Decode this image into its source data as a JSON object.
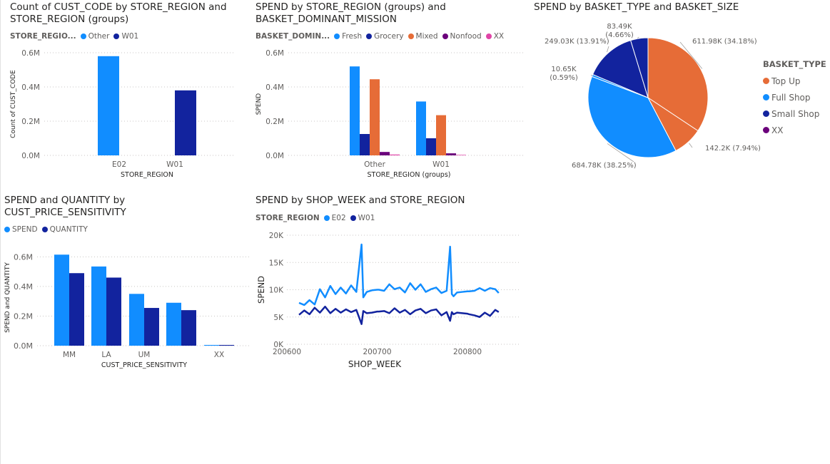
{
  "colors": {
    "light_blue": "#118dff",
    "dark_blue": "#12239e",
    "orange": "#e66c37",
    "purple": "#6b007b",
    "pink": "#e044a7",
    "axis_text": "#605e5c",
    "grid": "#c8c6c4"
  },
  "chart_data": [
    {
      "type": "bar",
      "title": "Count of CUST_CODE by STORE_REGION and\nSTORE_REGION (groups)",
      "legend_title": "STORE_REGIO...",
      "legend": [
        "Other",
        "W01"
      ],
      "categories": [
        "E02",
        "W01"
      ],
      "series": [
        {
          "name": "Other",
          "values": [
            580000,
            0
          ]
        },
        {
          "name": "W01",
          "values": [
            0,
            380000
          ]
        }
      ],
      "xlabel": "STORE_REGION",
      "ylabel": "Count of CUST_CODE",
      "ylim": [
        0,
        600000
      ],
      "yticks": [
        "0.0M",
        "0.2M",
        "0.4M",
        "0.6M"
      ],
      "grid": true
    },
    {
      "type": "bar",
      "title": "SPEND by STORE_REGION (groups) and\nBASKET_DOMINANT_MISSION",
      "legend_title": "BASKET_DOMIN...",
      "legend": [
        "Fresh",
        "Grocery",
        "Mixed",
        "Nonfood",
        "XX"
      ],
      "categories": [
        "Other",
        "W01"
      ],
      "series": [
        {
          "name": "Fresh",
          "values": [
            520000,
            315000
          ]
        },
        {
          "name": "Grocery",
          "values": [
            125000,
            100000
          ]
        },
        {
          "name": "Mixed",
          "values": [
            445000,
            235000
          ]
        },
        {
          "name": "Nonfood",
          "values": [
            20000,
            12000
          ]
        },
        {
          "name": "XX",
          "values": [
            5000,
            3000
          ]
        }
      ],
      "xlabel": "STORE_REGION (groups)",
      "ylabel": "SPEND",
      "ylim": [
        0,
        600000
      ],
      "yticks": [
        "0.0M",
        "0.2M",
        "0.4M",
        "0.6M"
      ],
      "grid": true
    },
    {
      "type": "pie",
      "title": "SPEND by BASKET_TYPE and BASKET_SIZE",
      "legend_title": "BASKET_TYPE",
      "legend": [
        "Top Up",
        "Full Shop",
        "Small Shop",
        "XX"
      ],
      "slices": [
        {
          "label": "611.98K (34.18%)",
          "value": 611.98,
          "color": "#e66c37"
        },
        {
          "label": "142.2K (7.94%)",
          "value": 142.2,
          "color": "#e66c37"
        },
        {
          "label": "684.78K (38.25%)",
          "value": 684.78,
          "color": "#118dff"
        },
        {
          "label": "10.65K\n(0.59%)",
          "value": 10.65,
          "color": "#118dff"
        },
        {
          "label": "249.03K (13.91%)",
          "value": 249.03,
          "color": "#12239e"
        },
        {
          "label": "83.49K\n(4.66%)",
          "value": 83.49,
          "color": "#12239e"
        }
      ]
    },
    {
      "type": "bar",
      "title": "SPEND and QUANTITY by\nCUST_PRICE_SENSITIVITY",
      "legend": [
        "SPEND",
        "QUANTITY"
      ],
      "categories": [
        "MM",
        "LA",
        "UM",
        "",
        "XX"
      ],
      "series": [
        {
          "name": "SPEND",
          "values": [
            615000,
            535000,
            350000,
            290000,
            5000
          ]
        },
        {
          "name": "QUANTITY",
          "values": [
            490000,
            460000,
            255000,
            240000,
            5000
          ]
        }
      ],
      "xlabel": "CUST_PRICE_SENSITIVITY",
      "ylabel": "SPEND and QUANTITY",
      "ylim": [
        0,
        650000
      ],
      "yticks": [
        "0.0M",
        "0.2M",
        "0.4M",
        "0.6M"
      ],
      "grid": true
    },
    {
      "type": "line",
      "title": "SPEND by SHOP_WEEK and STORE_REGION",
      "legend_title": "STORE_REGION",
      "legend": [
        "E02",
        "W01"
      ],
      "xlabel": "SHOP_WEEK",
      "ylabel": "SPEND",
      "xticks": [
        "200600",
        "200700",
        "200800"
      ],
      "yticks": [
        "0K",
        "5K",
        "10K",
        "15K",
        "20K"
      ],
      "xlim": [
        200600,
        200830
      ],
      "ylim": [
        0,
        20000
      ],
      "grid": true,
      "x": [
        200607,
        200610,
        200613,
        200616,
        200619,
        200622,
        200625,
        200628,
        200631,
        200634,
        200637,
        200640,
        200643,
        200644,
        200646,
        200649,
        200652,
        200701,
        200704,
        200707,
        200710,
        200713,
        200716,
        200719,
        200722,
        200725,
        200728,
        200731,
        200734,
        200737,
        200740,
        200742,
        200743,
        200744,
        200746,
        200749,
        200752,
        200801,
        200804,
        200807,
        200810,
        200813,
        200816,
        200818
      ],
      "series": [
        {
          "name": "E02",
          "values": [
            7600,
            7200,
            8100,
            7300,
            10100,
            8600,
            10700,
            9200,
            10400,
            9300,
            10800,
            9600,
            18300,
            8600,
            9600,
            9900,
            10000,
            10000,
            9800,
            11000,
            10100,
            10400,
            9500,
            11200,
            10000,
            11000,
            9600,
            10100,
            10400,
            9400,
            9800,
            17900,
            9200,
            8800,
            9500,
            9600,
            9700,
            9700,
            9800,
            10300,
            9800,
            10300,
            10100,
            9400
          ]
        },
        {
          "name": "W01",
          "values": [
            5400,
            6200,
            5500,
            6700,
            5800,
            6900,
            5700,
            6500,
            5800,
            6400,
            5900,
            6300,
            3700,
            6100,
            5700,
            5800,
            6000,
            6000,
            6100,
            5700,
            6600,
            5800,
            6300,
            5500,
            6200,
            6500,
            5700,
            6200,
            6400,
            5300,
            5900,
            4300,
            5900,
            5500,
            5800,
            5700,
            5600,
            5500,
            5300,
            5000,
            5800,
            5200,
            6300,
            5900
          ]
        }
      ]
    }
  ]
}
